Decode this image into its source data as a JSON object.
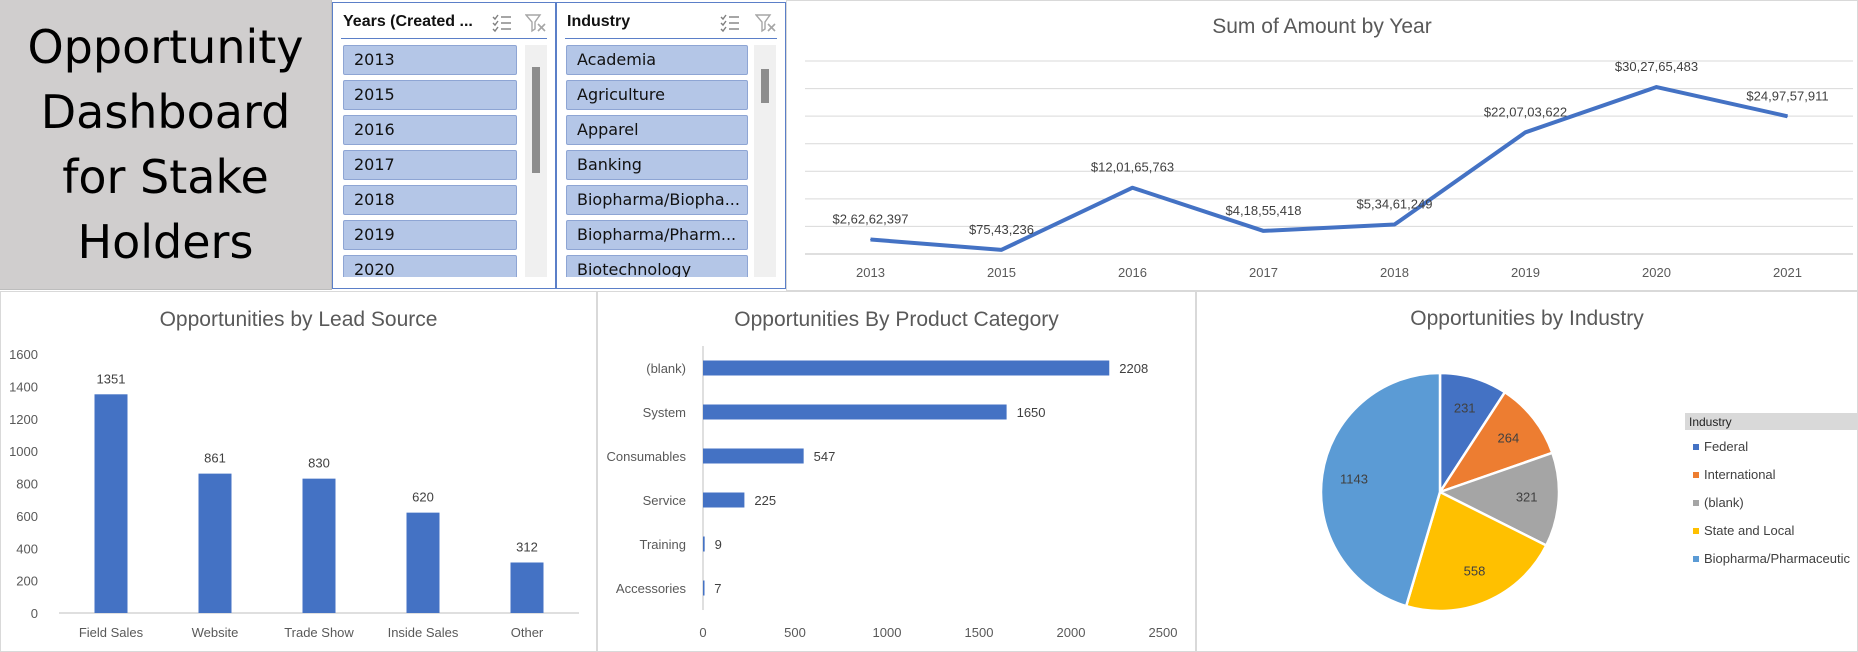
{
  "title_card": {
    "text": "Opportunity\nDashboard\nfor Stake\nHolders"
  },
  "slicers": {
    "years": {
      "title": "Years (Created ...",
      "items": [
        "2013",
        "2015",
        "2016",
        "2017",
        "2018",
        "2019",
        "2020"
      ]
    },
    "industry": {
      "title": "Industry",
      "items": [
        "Academia",
        "Agriculture",
        "Apparel",
        "Banking",
        "Biopharma/Biopha...",
        "Biopharma/Pharm...",
        "Biotechnology"
      ]
    },
    "icons": [
      "multi-select-icon",
      "clear-filter-icon"
    ]
  },
  "colors": {
    "accent": "#4472c4",
    "orange": "#ed7d31",
    "gray": "#a5a5a5",
    "gold": "#ffc000",
    "light_blue": "#5b9bd5",
    "slicer_item": "#b4c6e7",
    "title_card": "#d0cece"
  },
  "chart_data": [
    {
      "type": "line",
      "title": "Sum of Amount by Year",
      "categories": [
        "2013",
        "2015",
        "2016",
        "2017",
        "2018",
        "2019",
        "2020",
        "2021"
      ],
      "values": [
        26262397,
        7543236,
        120165763,
        41855418,
        53461249,
        220703622,
        302765483,
        249757911
      ],
      "data_labels": [
        "$2,62,62,397",
        "$75,43,236",
        "$12,01,65,763",
        "$4,18,55,418",
        "$5,34,61,249",
        "$22,07,03,622",
        "$30,27,65,483",
        "$24,97,57,911"
      ],
      "ylim": [
        0,
        350000000
      ],
      "grid": true,
      "color": "#4472c4"
    },
    {
      "type": "bar",
      "title": "Opportunities by Lead Source",
      "categories": [
        "Field Sales",
        "Website",
        "Trade Show",
        "Inside Sales",
        "Other"
      ],
      "values": [
        1351,
        861,
        830,
        620,
        312
      ],
      "ylim": [
        0,
        1600
      ],
      "yticks": [
        "0",
        "200",
        "400",
        "600",
        "800",
        "1000",
        "1200",
        "1400",
        "1600"
      ],
      "color": "#4472c4"
    },
    {
      "type": "bar",
      "orientation": "horizontal",
      "title": "Opportunities By Product Category",
      "categories": [
        "(blank)",
        "System",
        "Consumables",
        "Service",
        "Training",
        "Accessories"
      ],
      "values": [
        2208,
        1650,
        547,
        225,
        9,
        7
      ],
      "xlim": [
        0,
        2500
      ],
      "xticks": [
        "0",
        "500",
        "1000",
        "1500",
        "2000",
        "2500"
      ],
      "color": "#4472c4"
    },
    {
      "type": "pie",
      "title": "Opportunities by Industry",
      "legend_title": "Industry",
      "legend_position": "right",
      "slices": [
        {
          "label": "Federal",
          "value": 231,
          "color": "#4472c4"
        },
        {
          "label": "International",
          "value": 264,
          "color": "#ed7d31"
        },
        {
          "label": "(blank)",
          "value": 321,
          "color": "#a5a5a5"
        },
        {
          "label": "State and Local",
          "value": 558,
          "color": "#ffc000"
        },
        {
          "label": "Biopharma/Pharmaceutic",
          "value": 1143,
          "color": "#5b9bd5"
        }
      ]
    }
  ]
}
